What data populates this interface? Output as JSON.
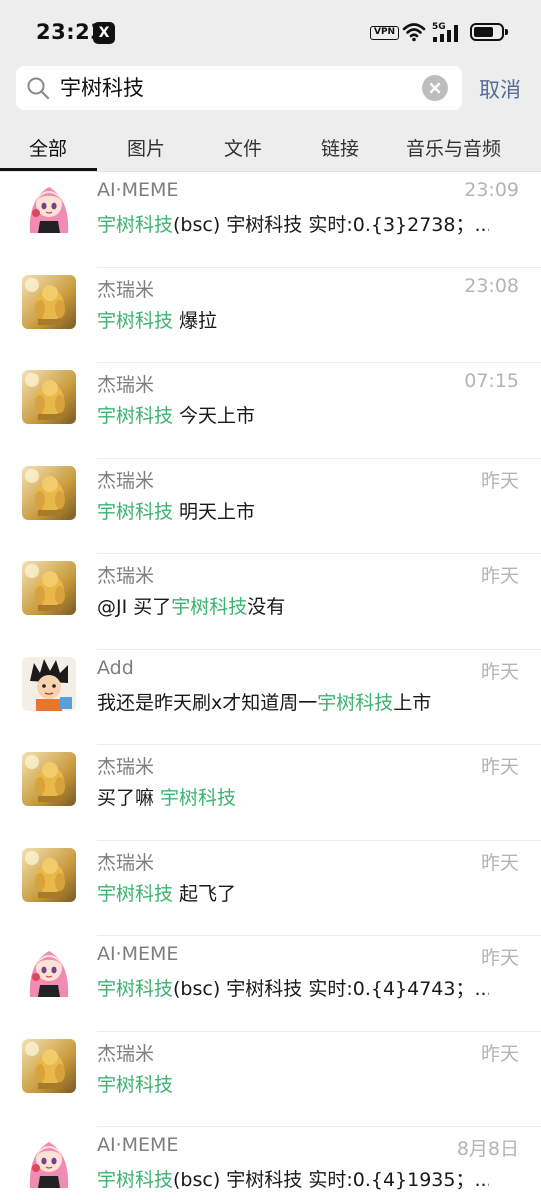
{
  "status_bar": {
    "time": "23:23",
    "app_badge": "X",
    "vpn": "VPN",
    "network": "5G"
  },
  "search": {
    "query": "宇树科技",
    "cancel_label": "取消"
  },
  "tabs": [
    {
      "label": "全部",
      "active": true
    },
    {
      "label": "图片",
      "active": false
    },
    {
      "label": "文件",
      "active": false
    },
    {
      "label": "链接",
      "active": false
    },
    {
      "label": "音乐与音频",
      "active": false
    }
  ],
  "colors": {
    "highlight": "#3cb371",
    "cancel": "#576b95",
    "header_bg": "#ededed"
  },
  "results": [
    {
      "avatar": "anime-girl-avatar",
      "name": "AI·MEME",
      "time": "23:09",
      "pre": "",
      "hl": "宇树科技",
      "post": "(bsc) 宇树科技 实时:0.{3}2738；..."
    },
    {
      "avatar": "golden-statue-avatar",
      "name": "杰瑞米",
      "time": "23:08",
      "pre": "",
      "hl": "宇树科技",
      "post": " 爆拉"
    },
    {
      "avatar": "golden-statue-avatar",
      "name": "杰瑞米",
      "time": "07:15",
      "pre": "",
      "hl": "宇树科技",
      "post": " 今天上市"
    },
    {
      "avatar": "golden-statue-avatar",
      "name": "杰瑞米",
      "time": "昨天",
      "pre": "",
      "hl": "宇树科技",
      "post": " 明天上市"
    },
    {
      "avatar": "golden-statue-avatar",
      "name": "杰瑞米",
      "time": "昨天",
      "pre": "@JI 买了",
      "hl": "宇树科技",
      "post": "没有"
    },
    {
      "avatar": "cartoon-boy-avatar",
      "name": "Add",
      "time": "昨天",
      "pre": "我还是昨天刷x才知道周一",
      "hl": "宇树科技",
      "post": "上市"
    },
    {
      "avatar": "golden-statue-avatar",
      "name": "杰瑞米",
      "time": "昨天",
      "pre": "买了嘛 ",
      "hl": "宇树科技",
      "post": ""
    },
    {
      "avatar": "golden-statue-avatar",
      "name": "杰瑞米",
      "time": "昨天",
      "pre": "",
      "hl": "宇树科技",
      "post": " 起飞了"
    },
    {
      "avatar": "anime-girl-avatar",
      "name": "AI·MEME",
      "time": "昨天",
      "pre": "",
      "hl": "宇树科技",
      "post": "(bsc) 宇树科技 实时:0.{4}4743；..."
    },
    {
      "avatar": "golden-statue-avatar",
      "name": "杰瑞米",
      "time": "昨天",
      "pre": "",
      "hl": "宇树科技",
      "post": ""
    },
    {
      "avatar": "anime-girl-avatar",
      "name": "AI·MEME",
      "time": "8月8日",
      "pre": "",
      "hl": "宇树科技",
      "post": "(bsc) 宇树科技 实时:0.{4}1935；..."
    }
  ]
}
